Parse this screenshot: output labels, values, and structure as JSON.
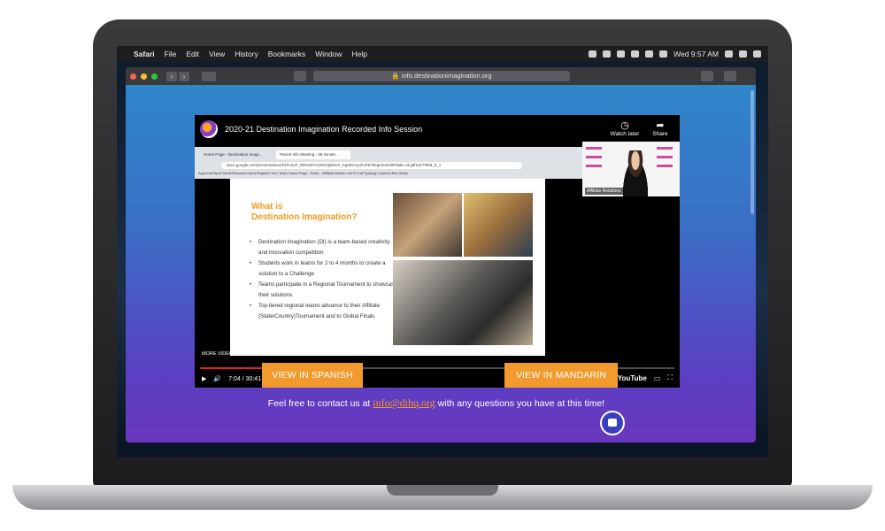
{
  "menubar": {
    "apple": "",
    "app": "Safari",
    "items": [
      "File",
      "Edit",
      "View",
      "History",
      "Bookmarks",
      "Window",
      "Help"
    ],
    "clock": "Wed 9:57 AM"
  },
  "browser": {
    "url": "info.destinationimagination.org"
  },
  "video": {
    "title": "2020-21 Destination Imagination Recorded Info Session",
    "watch_later": "Watch later",
    "share": "Share",
    "time": "7:04 / 30:41",
    "progress": 0.23,
    "more_videos": "MORE VIDEOS",
    "brand": "YouTube"
  },
  "inner": {
    "tab1": "Home Page - Destination Imagi...",
    "tab2": "Parent Info Meeting - 45 minute...",
    "url": "docs.google.com/presentation/d/1Fu2oF_RRsrsk7A2NCfqN5GX_Kg0DrCyuFvP67kKgOIo/edit#slide=id.g8f1017f308_0_1",
    "bookmarks": "Apps   HubSpot   Gmail   Resource Area   Register Your Team   Home Page - Desti...   Affiliate Master List   DI Cal   Synergy Connect   Box   Wrike"
  },
  "slide": {
    "title": "What is\nDestination Imagination?",
    "bullets": [
      "Destination Imagination (DI) is a team-based creativity and innovation competition",
      "Students work in teams for 2 to 4 months to create a solution to a Challenge",
      "Teams participate in a Regional Tournament to showcase their solutions",
      "Top-tiered regional teams advance to their Affiliate (State/Country)Tournament and to Global Finals"
    ]
  },
  "pip": {
    "label": "Affiliate Relations"
  },
  "page": {
    "btn_spanish": "VIEW IN SPANISH",
    "btn_mandarin": "VIEW IN MANDARIN",
    "contact_pre": "Feel free to contact us at ",
    "contact_email": "info@dihq.org",
    "contact_post": " with any questions you have at this time!"
  },
  "colors": {
    "accent": "#f39a2e",
    "gradient_top": "#2f86c8",
    "gradient_bottom": "#6a36c0"
  }
}
